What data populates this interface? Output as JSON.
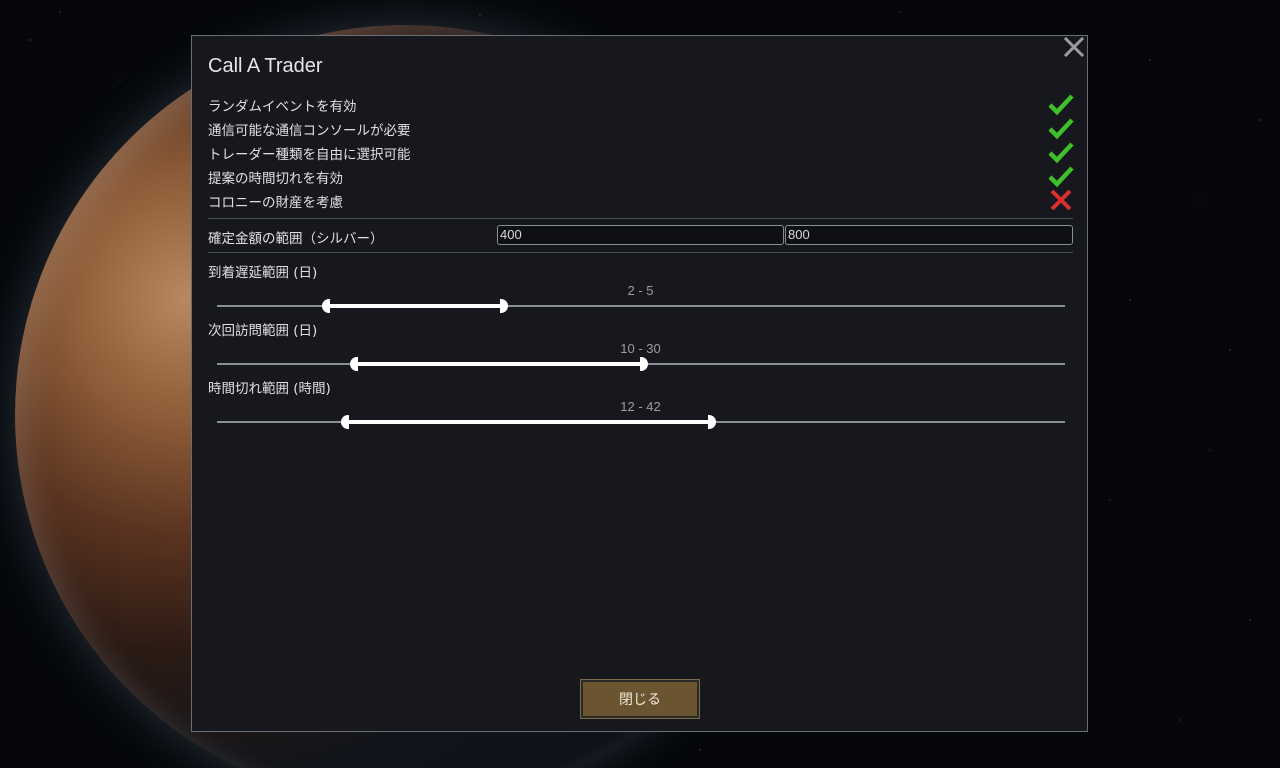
{
  "dialog": {
    "title": "Call A Trader"
  },
  "options": [
    {
      "label": "ランダムイベントを有効",
      "checked": true
    },
    {
      "label": "通信可能な通信コンソールが必要",
      "checked": true
    },
    {
      "label": "トレーダー種類を自由に選択可能",
      "checked": true
    },
    {
      "label": "提案の時間切れを有効",
      "checked": true
    },
    {
      "label": "コロニーの財産を考慮",
      "checked": false
    }
  ],
  "fixed_amount": {
    "label": "確定金額の範囲（シルバー）",
    "min_value": "400",
    "max_value": "800"
  },
  "sliders": [
    {
      "label": "到着遅延範囲 (日)",
      "value_text": "2 - 5",
      "low_fraction": 0.128,
      "high_fraction": 0.338
    },
    {
      "label": "次回訪問範囲 (日)",
      "value_text": "10 - 30",
      "low_fraction": 0.161,
      "high_fraction": 0.504
    },
    {
      "label": "時間切れ範囲 (時間)",
      "value_text": "12 - 42",
      "low_fraction": 0.151,
      "high_fraction": 0.584
    }
  ],
  "footer": {
    "close_label": "閉じる"
  },
  "colors": {
    "check_green": "#3fbf2a",
    "cross_red": "#d83030",
    "button_brown": "#6b5430"
  }
}
